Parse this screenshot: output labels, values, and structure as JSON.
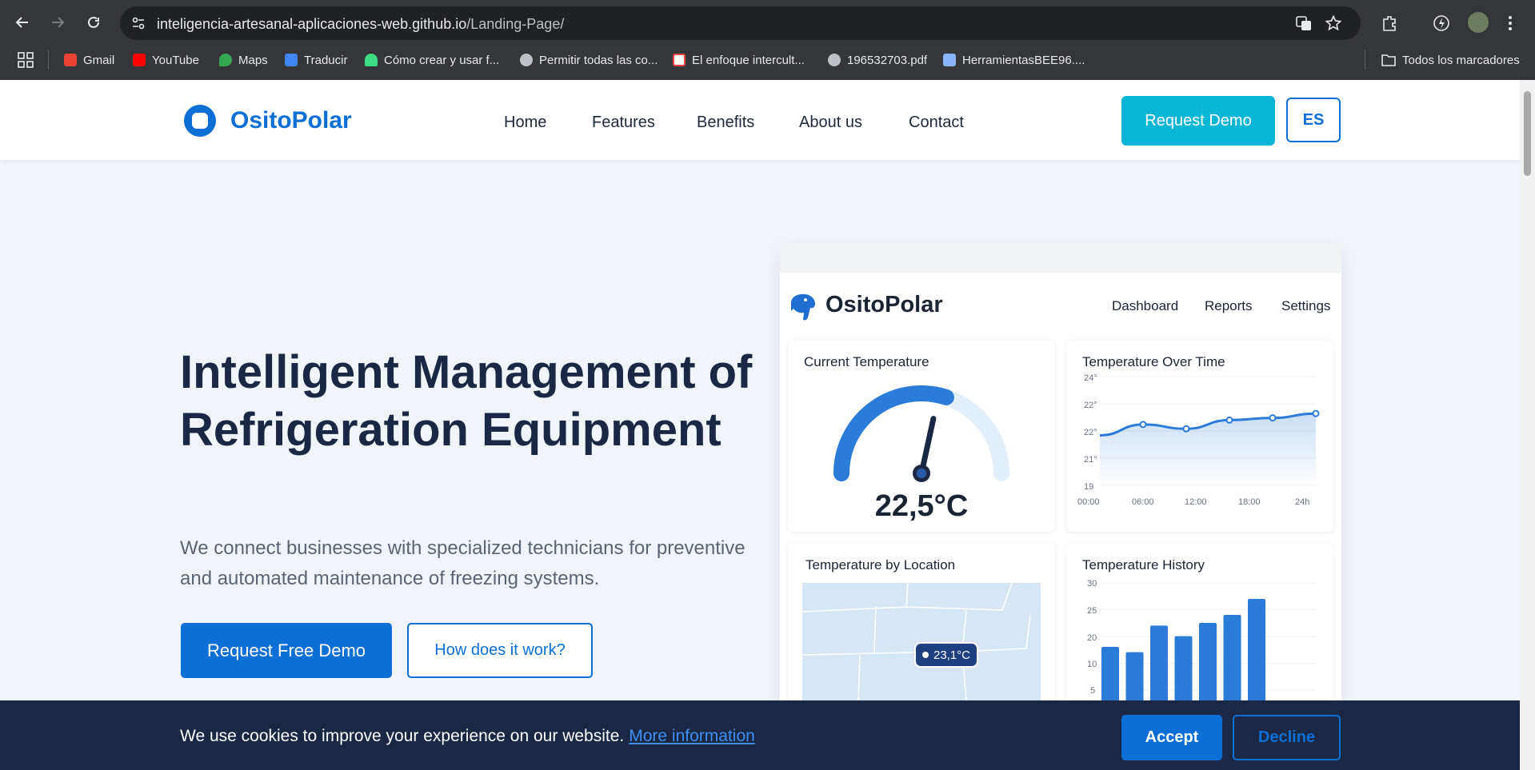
{
  "browser": {
    "url_host": "inteligencia-artesanal-aplicaciones-web.github.io",
    "url_path": "/Landing-Page/",
    "bookmarks": [
      {
        "label": "Gmail",
        "icon": "gmail-icon",
        "color": "#ea4335"
      },
      {
        "label": "YouTube",
        "icon": "youtube-icon",
        "color": "#ff0000"
      },
      {
        "label": "Maps",
        "icon": "maps-icon",
        "color": "#34a853"
      },
      {
        "label": "Traducir",
        "icon": "translate-icon",
        "color": "#4285f4"
      },
      {
        "label": "Cómo crear y usar f...",
        "icon": "android-icon",
        "color": "#3ddc84"
      },
      {
        "label": "Permitir todas las co...",
        "icon": "globe-icon",
        "color": "#bdc1c6"
      },
      {
        "label": "El enfoque intercult...",
        "icon": "pdf-icon",
        "color": "#e44"
      },
      {
        "label": "196532703.pdf",
        "icon": "globe-icon",
        "color": "#bdc1c6"
      },
      {
        "label": "HerramientasBEE96....",
        "icon": "doc-icon",
        "color": "#8ab4f8"
      }
    ],
    "all_bookmarks": "Todos los marcadores"
  },
  "header": {
    "brand": "OsitoPolar",
    "nav": [
      "Home",
      "Features",
      "Benefits",
      "About us",
      "Contact"
    ],
    "cta": "Request Demo",
    "lang": "ES"
  },
  "hero": {
    "title": "Intelligent Management of Refrigeration Equipment",
    "subtitle": "We connect businesses with specialized technicians for preventive and automated maintenance of freezing systems.",
    "primary_button": "Request Free Demo",
    "secondary_button": "How does it work?"
  },
  "dashboard": {
    "brand": "OsitoPolar",
    "nav": [
      "Dashboard",
      "Reports",
      "Settings"
    ],
    "current_temp": {
      "title": "Current Temperature",
      "value": "22,5°C",
      "level": 0.6
    },
    "over_time": {
      "title": "Temperature Over Time",
      "y_ticks": [
        "24°",
        "22°",
        "22°",
        "21°",
        "19"
      ],
      "x_ticks": [
        "00:00",
        "06:00",
        "12:00",
        "18:00",
        "24h"
      ]
    },
    "location": {
      "title": "Temperature by Location",
      "pin": "23,1°C"
    },
    "history": {
      "title": "Temperature History",
      "y_ticks": [
        "30",
        "25",
        "20",
        "10",
        "5"
      ]
    }
  },
  "chart_data": [
    {
      "type": "line",
      "title": "Temperature Over Time",
      "x": [
        "00:00",
        "06:00",
        "12:00",
        "18:00",
        "24h"
      ],
      "values": [
        21.3,
        21.8,
        21.6,
        22.0,
        22.1,
        22.3
      ]
    },
    {
      "type": "bar",
      "title": "Temperature History",
      "values": [
        18,
        17,
        22,
        20,
        22.5,
        24,
        27
      ],
      "ylim": [
        0,
        30
      ]
    }
  ],
  "cookie": {
    "text": "We use cookies to improve your experience on our website.",
    "link": "More information",
    "accept": "Accept",
    "decline": "Decline"
  }
}
